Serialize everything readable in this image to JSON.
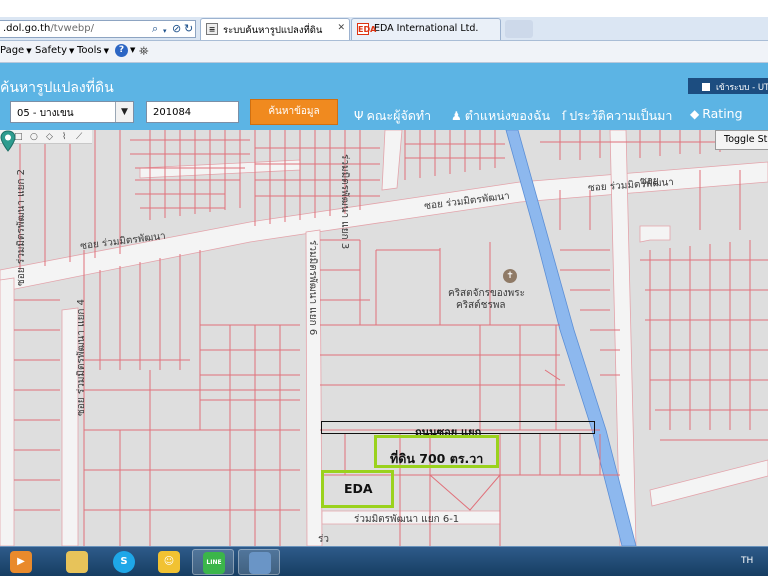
{
  "browser": {
    "address_host": ".dol.go.th",
    "address_path": "/tvwebp/",
    "tabs": [
      {
        "label": "ระบบค้นหารูปแปลงที่ดิน",
        "favicon": "page-icon"
      },
      {
        "label": "EDA International Ltd.",
        "favicon": "EDA"
      }
    ],
    "menu": {
      "page": "Page",
      "safety": "Safety",
      "tools": "Tools"
    }
  },
  "app": {
    "title": "ค้นหารูปแปลงที่ดิน",
    "login": {
      "label": "เข้าระบบ",
      "utm": "UT"
    },
    "district_select": {
      "value": "05 - บางเขน"
    },
    "parcel_input": {
      "value": "201084"
    },
    "search_button": "ค้นหาข้อมูล",
    "nav": {
      "committee": "คณะผู้จัดทำ",
      "my_location": "ตำแหน่งของฉัน",
      "history": "ประวัติความเป็นมา",
      "rating": "Rating"
    },
    "toggle_button": "Toggle Street"
  },
  "map": {
    "streets": {
      "soi_top_right": "ซอย ร่วมมิตรพัฒนา",
      "soi_top_right_2": "ซอย",
      "soi_center": "ซอย ร่วมมิตรพัฒนา",
      "soi_left": "ซอย ร่วมมิตรพัฒนา",
      "soi_v3": "ร่วมมิตรพัฒนา แยก 3",
      "soi_v2": "ซอย ร่วมมิตรพัฒนา แยก 2",
      "soi_v4": "ซอย ร่วมมิตรพัฒนา แยก 4",
      "soi_v6": "ร่วมมิตรพัฒนา แยก 6",
      "soi_6_1": "ร่วมมิตรพัฒนา แยก 6-1",
      "edge": "ร่ว"
    },
    "poi": {
      "church_line1": "คริสตจักรของพระ",
      "church_line2": "คริสต์ชรพล"
    },
    "road_annotation": "ถนนซอย แยก",
    "parcel_annotation": "ที่ดิน 700 ตร.วา",
    "eda_annotation": "EDA",
    "colors": {
      "parcel_line": "#e0707a",
      "road": "#f4f4f4",
      "canal": "#8db8ee",
      "highlight": "#9ad21d",
      "header": "#5cb4e4",
      "search_button": "#f08a1f"
    }
  },
  "taskbar": {
    "apps": [
      "media-player-icon",
      "folder-icon",
      "skype-icon",
      "messenger-icon",
      "line-icon",
      "window-icon"
    ],
    "skype_glyph": "S",
    "line_glyph": "LINE",
    "language": "TH"
  }
}
